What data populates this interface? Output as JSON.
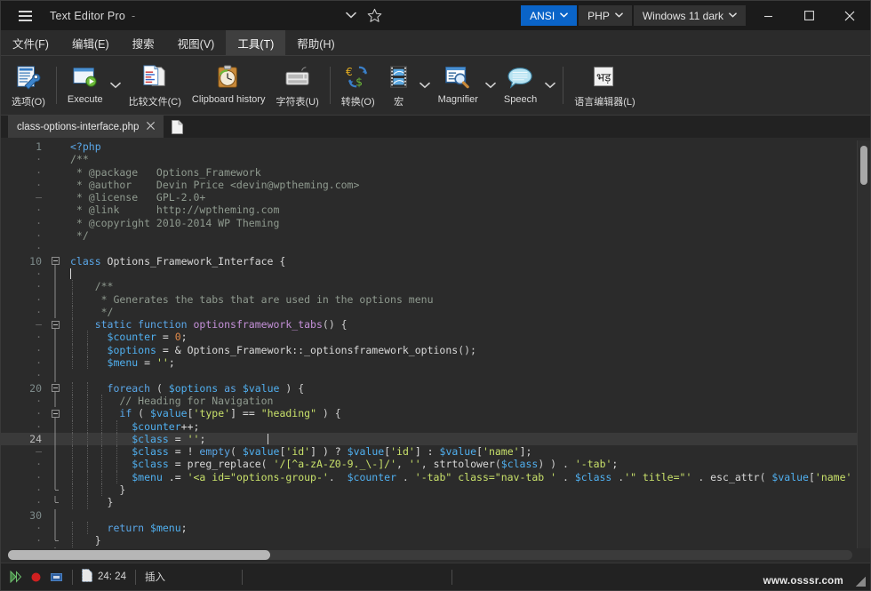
{
  "window": {
    "title": "Text Editor Pro",
    "title_suffix": "-",
    "menu_icon": "hamburger-icon",
    "chevron_icon": "chevron-down-icon",
    "star_icon": "star-icon",
    "encoding": "ANSI",
    "language": "PHP",
    "theme": "Windows 11 dark",
    "accent_color": "#0a64c8",
    "minimize_label": "Minimize",
    "maximize_label": "Maximize",
    "close_label": "Close"
  },
  "menubar": {
    "items": [
      {
        "label": "文件(F)",
        "selected": false
      },
      {
        "label": "编辑(E)",
        "selected": false
      },
      {
        "label": "搜索",
        "selected": false
      },
      {
        "label": "视图(V)",
        "selected": false
      },
      {
        "label": "工具(T)",
        "selected": true
      },
      {
        "label": "帮助(H)",
        "selected": false
      }
    ]
  },
  "toolbar": {
    "buttons": [
      {
        "label": "选项(O)",
        "icon": "options-wrench-icon",
        "dropdown": false
      },
      {
        "label": "Execute",
        "icon": "execute-play-icon",
        "dropdown": true
      },
      {
        "label": "比较文件(C)",
        "icon": "compare-files-icon",
        "dropdown": false
      },
      {
        "label": "Clipboard history",
        "icon": "clipboard-clock-icon",
        "dropdown": false
      },
      {
        "label": "字符表(U)",
        "icon": "keyboard-icon",
        "dropdown": false
      },
      {
        "label": "转换(O)",
        "icon": "currency-convert-icon",
        "dropdown": false
      },
      {
        "label": "宏",
        "icon": "macro-filmstrip-icon",
        "dropdown": true
      },
      {
        "label": "Magnifier",
        "icon": "magnifier-icon",
        "dropdown": true
      },
      {
        "label": "Speech",
        "icon": "speech-bubble-icon",
        "dropdown": true
      },
      {
        "label": "语言编辑器(L)",
        "icon": "language-editor-icon",
        "dropdown": false
      }
    ]
  },
  "doctabs": {
    "tabs": [
      {
        "label": "class-options-interface.php",
        "close_icon": "close-icon",
        "active": true
      }
    ],
    "new_tab_icon": "new-document-icon"
  },
  "editor": {
    "current_line": 24,
    "lines": [
      {
        "num": "1",
        "gutter": "num",
        "fold": "none",
        "indent_guides": 0,
        "tokens": [
          {
            "t": "<?php",
            "c": "k"
          }
        ]
      },
      {
        "num": "-",
        "gutter": "dot",
        "fold": "none",
        "indent_guides": 0,
        "tokens": [
          {
            "t": "/**",
            "c": "cm"
          }
        ]
      },
      {
        "num": "-",
        "gutter": "dot",
        "fold": "none",
        "indent_guides": 0,
        "tokens": [
          {
            "t": " * @package   Options_Framework",
            "c": "cm"
          }
        ]
      },
      {
        "num": "-",
        "gutter": "dot",
        "fold": "none",
        "indent_guides": 0,
        "tokens": [
          {
            "t": " * @author    Devin Price <devin@wptheming.com>",
            "c": "cm"
          }
        ]
      },
      {
        "num": "-",
        "gutter": "dash",
        "fold": "none",
        "indent_guides": 0,
        "tokens": [
          {
            "t": " * @license   GPL-2.0+",
            "c": "cm"
          }
        ]
      },
      {
        "num": "-",
        "gutter": "dot",
        "fold": "none",
        "indent_guides": 0,
        "tokens": [
          {
            "t": " * @link      http://wptheming.com",
            "c": "cm"
          }
        ]
      },
      {
        "num": "-",
        "gutter": "dot",
        "fold": "none",
        "indent_guides": 0,
        "tokens": [
          {
            "t": " * @copyright 2010-2014 WP Theming",
            "c": "cm"
          }
        ]
      },
      {
        "num": "-",
        "gutter": "dot",
        "fold": "none",
        "indent_guides": 0,
        "tokens": [
          {
            "t": " */",
            "c": "cm"
          }
        ]
      },
      {
        "num": "-",
        "gutter": "dot",
        "fold": "none",
        "indent_guides": 0,
        "tokens": []
      },
      {
        "num": "10",
        "gutter": "num",
        "fold": "box",
        "indent_guides": 0,
        "tokens": [
          {
            "t": "class",
            "c": "k"
          },
          {
            "t": " Options_Framework_Interface {",
            "c": "cls"
          }
        ]
      },
      {
        "num": "-",
        "gutter": "dot",
        "fold": "line",
        "indent_guides": 0,
        "tokens": [
          {
            "t": "",
            "c": "op"
          },
          {
            "t": "caret",
            "c": "caret"
          }
        ]
      },
      {
        "num": "-",
        "gutter": "dot",
        "fold": "line",
        "indent_guides": 1,
        "tokens": [
          {
            "t": "    /**",
            "c": "cm"
          }
        ]
      },
      {
        "num": "-",
        "gutter": "dot",
        "fold": "line",
        "indent_guides": 1,
        "tokens": [
          {
            "t": "     * Generates the tabs that are used in the options menu",
            "c": "cm"
          }
        ]
      },
      {
        "num": "-",
        "gutter": "dot",
        "fold": "line",
        "indent_guides": 1,
        "tokens": [
          {
            "t": "     */",
            "c": "cm"
          }
        ]
      },
      {
        "num": "-",
        "gutter": "dash",
        "fold": "box",
        "indent_guides": 1,
        "tokens": [
          {
            "t": "    ",
            "c": "op"
          },
          {
            "t": "static function",
            "c": "k"
          },
          {
            "t": " ",
            "c": "op"
          },
          {
            "t": "optionsframework_tabs",
            "c": "fn"
          },
          {
            "t": "() {",
            "c": "pun"
          }
        ]
      },
      {
        "num": "-",
        "gutter": "dot",
        "fold": "line",
        "indent_guides": 2,
        "tokens": [
          {
            "t": "      ",
            "c": "op"
          },
          {
            "t": "$counter",
            "c": "var"
          },
          {
            "t": " = ",
            "c": "op"
          },
          {
            "t": "0",
            "c": "num"
          },
          {
            "t": ";",
            "c": "op"
          }
        ]
      },
      {
        "num": "-",
        "gutter": "dot",
        "fold": "line",
        "indent_guides": 2,
        "tokens": [
          {
            "t": "      ",
            "c": "op"
          },
          {
            "t": "$options",
            "c": "var"
          },
          {
            "t": " = & ",
            "c": "op"
          },
          {
            "t": "Options_Framework::_optionsframework_options",
            "c": "cls"
          },
          {
            "t": "();",
            "c": "pun"
          }
        ]
      },
      {
        "num": "-",
        "gutter": "dot",
        "fold": "line",
        "indent_guides": 2,
        "tokens": [
          {
            "t": "      ",
            "c": "op"
          },
          {
            "t": "$menu",
            "c": "var"
          },
          {
            "t": " = ",
            "c": "op"
          },
          {
            "t": "''",
            "c": "str"
          },
          {
            "t": ";",
            "c": "op"
          }
        ]
      },
      {
        "num": "-",
        "gutter": "dot",
        "fold": "line",
        "indent_guides": 2,
        "tokens": []
      },
      {
        "num": "20",
        "gutter": "num",
        "fold": "box",
        "indent_guides": 2,
        "tokens": [
          {
            "t": "      ",
            "c": "op"
          },
          {
            "t": "foreach",
            "c": "k"
          },
          {
            "t": " ( ",
            "c": "pun"
          },
          {
            "t": "$options",
            "c": "var"
          },
          {
            "t": " ",
            "c": "op"
          },
          {
            "t": "as",
            "c": "k"
          },
          {
            "t": " ",
            "c": "op"
          },
          {
            "t": "$value",
            "c": "var"
          },
          {
            "t": " ) {",
            "c": "pun"
          }
        ]
      },
      {
        "num": "-",
        "gutter": "dot",
        "fold": "line",
        "indent_guides": 3,
        "tokens": [
          {
            "t": "        // Heading for Navigation",
            "c": "cm"
          }
        ]
      },
      {
        "num": "-",
        "gutter": "dot",
        "fold": "box",
        "indent_guides": 3,
        "tokens": [
          {
            "t": "        ",
            "c": "op"
          },
          {
            "t": "if",
            "c": "k"
          },
          {
            "t": " ( ",
            "c": "pun"
          },
          {
            "t": "$value",
            "c": "var"
          },
          {
            "t": "[",
            "c": "pun"
          },
          {
            "t": "'type'",
            "c": "str"
          },
          {
            "t": "] == ",
            "c": "op"
          },
          {
            "t": "\"heading\"",
            "c": "str"
          },
          {
            "t": " ) {",
            "c": "pun"
          }
        ]
      },
      {
        "num": "-",
        "gutter": "dot",
        "fold": "line",
        "indent_guides": 4,
        "tokens": [
          {
            "t": "          ",
            "c": "op"
          },
          {
            "t": "$counter",
            "c": "var"
          },
          {
            "t": "++;",
            "c": "op"
          }
        ]
      },
      {
        "num": "24",
        "gutter": "num",
        "fold": "line",
        "indent_guides": 4,
        "current": true,
        "tokens": [
          {
            "t": "          ",
            "c": "op"
          },
          {
            "t": "$class",
            "c": "var"
          },
          {
            "t": " = ",
            "c": "op"
          },
          {
            "t": "''",
            "c": "str"
          },
          {
            "t": ";",
            "c": "op"
          },
          {
            "t": "          ",
            "c": "op"
          },
          {
            "t": "caret",
            "c": "caret"
          }
        ]
      },
      {
        "num": "-",
        "gutter": "dash",
        "fold": "line",
        "indent_guides": 4,
        "tokens": [
          {
            "t": "          ",
            "c": "op"
          },
          {
            "t": "$class",
            "c": "var"
          },
          {
            "t": " = ! ",
            "c": "op"
          },
          {
            "t": "empty",
            "c": "k"
          },
          {
            "t": "( ",
            "c": "pun"
          },
          {
            "t": "$value",
            "c": "var"
          },
          {
            "t": "[",
            "c": "pun"
          },
          {
            "t": "'id'",
            "c": "str"
          },
          {
            "t": "] ) ? ",
            "c": "op"
          },
          {
            "t": "$value",
            "c": "var"
          },
          {
            "t": "[",
            "c": "pun"
          },
          {
            "t": "'id'",
            "c": "str"
          },
          {
            "t": "] : ",
            "c": "op"
          },
          {
            "t": "$value",
            "c": "var"
          },
          {
            "t": "[",
            "c": "pun"
          },
          {
            "t": "'name'",
            "c": "str"
          },
          {
            "t": "];",
            "c": "op"
          }
        ]
      },
      {
        "num": "-",
        "gutter": "dot",
        "fold": "line",
        "indent_guides": 4,
        "tokens": [
          {
            "t": "          ",
            "c": "op"
          },
          {
            "t": "$class",
            "c": "var"
          },
          {
            "t": " = ",
            "c": "op"
          },
          {
            "t": "preg_replace",
            "c": "cls"
          },
          {
            "t": "( ",
            "c": "pun"
          },
          {
            "t": "'/[^a-zA-Z0-9._\\-]/'",
            "c": "str"
          },
          {
            "t": ", ",
            "c": "pun"
          },
          {
            "t": "''",
            "c": "str"
          },
          {
            "t": ", ",
            "c": "pun"
          },
          {
            "t": "strtolower",
            "c": "cls"
          },
          {
            "t": "(",
            "c": "pun"
          },
          {
            "t": "$class",
            "c": "var"
          },
          {
            "t": ") ) . ",
            "c": "pun"
          },
          {
            "t": "'-tab'",
            "c": "str"
          },
          {
            "t": ";",
            "c": "op"
          }
        ]
      },
      {
        "num": "-",
        "gutter": "dot",
        "fold": "line",
        "indent_guides": 4,
        "tokens": [
          {
            "t": "          ",
            "c": "op"
          },
          {
            "t": "$menu",
            "c": "var"
          },
          {
            "t": " .= ",
            "c": "op"
          },
          {
            "t": "'<a id=\"options-group-'",
            "c": "str"
          },
          {
            "t": ".  ",
            "c": "pun"
          },
          {
            "t": "$counter",
            "c": "var"
          },
          {
            "t": " . ",
            "c": "pun"
          },
          {
            "t": "'-tab\" class=\"nav-tab '",
            "c": "str"
          },
          {
            "t": " . ",
            "c": "pun"
          },
          {
            "t": "$class",
            "c": "var"
          },
          {
            "t": " .",
            "c": "pun"
          },
          {
            "t": "'\" title=\"'",
            "c": "str"
          },
          {
            "t": " . ",
            "c": "pun"
          },
          {
            "t": "esc_attr",
            "c": "cls"
          },
          {
            "t": "( ",
            "c": "pun"
          },
          {
            "t": "$value",
            "c": "var"
          },
          {
            "t": "[",
            "c": "pun"
          },
          {
            "t": "'name'",
            "c": "str"
          }
        ]
      },
      {
        "num": "-",
        "gutter": "dot",
        "fold": "elbow",
        "indent_guides": 3,
        "tokens": [
          {
            "t": "        }",
            "c": "pun"
          }
        ]
      },
      {
        "num": "-",
        "gutter": "dot",
        "fold": "elbow",
        "indent_guides": 2,
        "tokens": [
          {
            "t": "      }",
            "c": "pun"
          }
        ]
      },
      {
        "num": "30",
        "gutter": "num",
        "fold": "line",
        "indent_guides": 2,
        "tokens": []
      },
      {
        "num": "-",
        "gutter": "dot",
        "fold": "line",
        "indent_guides": 2,
        "tokens": [
          {
            "t": "      ",
            "c": "op"
          },
          {
            "t": "return",
            "c": "k"
          },
          {
            "t": " ",
            "c": "op"
          },
          {
            "t": "$menu",
            "c": "var"
          },
          {
            "t": ";",
            "c": "op"
          }
        ]
      },
      {
        "num": "-",
        "gutter": "dot",
        "fold": "elbow",
        "indent_guides": 1,
        "tokens": [
          {
            "t": "    }",
            "c": "pun"
          }
        ]
      },
      {
        "num": "-",
        "gutter": "dot",
        "fold": "line",
        "indent_guides": 0,
        "tokens": []
      }
    ]
  },
  "statusbar": {
    "run_icon": "run-icon",
    "stop_icon": "stop-record-icon",
    "pause_icon": "pause-icon",
    "position_icon": "document-position-icon",
    "position": "24: 24",
    "insert_mode": "插入",
    "watermark": "www.osssr.com",
    "resize_grip": "resize-grip-icon"
  }
}
